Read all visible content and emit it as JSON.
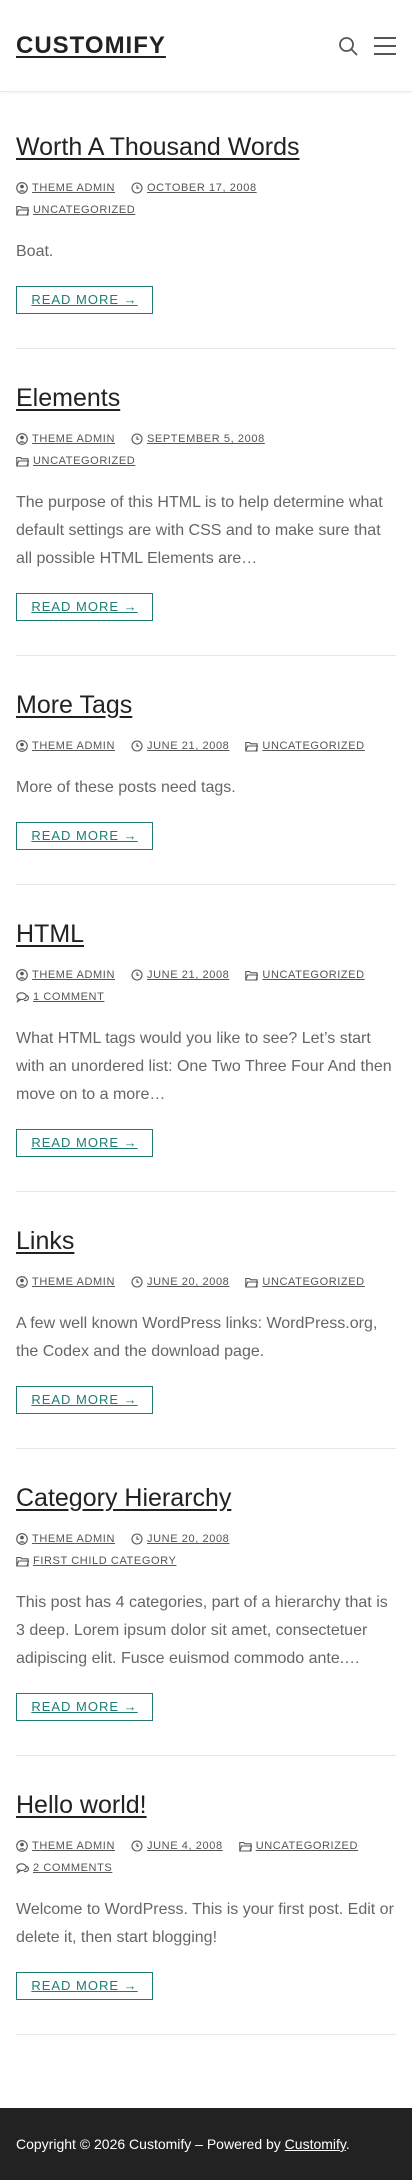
{
  "header": {
    "site_title": "CUSTOMIFY",
    "icons": [
      "search-icon",
      "menu-icon"
    ]
  },
  "posts": [
    {
      "title": "Worth A Thousand Words",
      "author": "THEME ADMIN",
      "date": "OCTOBER 17, 2008",
      "category": "UNCATEGORIZED",
      "excerpt": "Boat.",
      "read_more": "READ MORE →"
    },
    {
      "title": "Elements",
      "author": "THEME ADMIN",
      "date": "SEPTEMBER 5, 2008",
      "category": "UNCATEGORIZED",
      "excerpt": "The purpose of this HTML is to help determine what default settings are with CSS and to make sure that all possible HTML Elements are…",
      "read_more": "READ MORE →"
    },
    {
      "title": "More Tags",
      "author": "THEME ADMIN",
      "date": "JUNE 21, 2008",
      "category": "UNCATEGORIZED",
      "excerpt": "More of these posts need tags.",
      "read_more": "READ MORE →"
    },
    {
      "title": "HTML",
      "author": "THEME ADMIN",
      "date": "JUNE 21, 2008",
      "category": "UNCATEGORIZED",
      "comments": "1 COMMENT",
      "excerpt": "What HTML tags would you like to see? Let’s start with an unordered list: One Two Three Four And then move on to a more…",
      "read_more": "READ MORE →"
    },
    {
      "title": "Links",
      "author": "THEME ADMIN",
      "date": "JUNE 20, 2008",
      "category": "UNCATEGORIZED",
      "excerpt": "A few well known WordPress links: WordPress.org, the Codex and the download page.",
      "read_more": "READ MORE →"
    },
    {
      "title": "Category Hierarchy",
      "author": "THEME ADMIN",
      "date": "JUNE 20, 2008",
      "category": "FIRST CHILD CATEGORY",
      "excerpt": "This post has 4 categories, part of a hierarchy that is 3 deep. Lorem ipsum dolor sit amet, consectetuer adipiscing elit. Fusce euismod commodo ante.…",
      "read_more": "READ MORE →"
    },
    {
      "title": "Hello world!",
      "author": "THEME ADMIN",
      "date": "JUNE 4, 2008",
      "category": "UNCATEGORIZED",
      "comments": "2 COMMENTS",
      "excerpt": "Welcome to WordPress. This is your first post. Edit or delete it, then start blogging!",
      "read_more": "READ MORE →"
    }
  ],
  "footer": {
    "text": "Copyright © 2026 Customify – Powered by ",
    "link": "Customify",
    "end": "."
  },
  "colors": {
    "accent": "#1e7d72",
    "footer_bg": "#222222",
    "text": "#666666"
  }
}
